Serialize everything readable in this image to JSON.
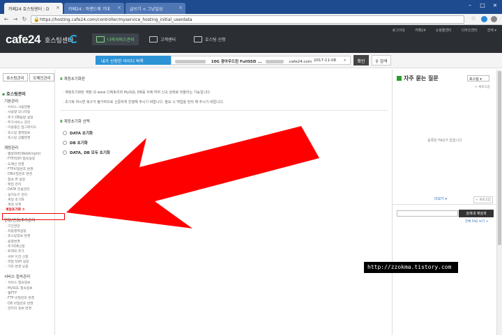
{
  "browser": {
    "tabs": [
      {
        "label": "카페24 호스팅센터 : D",
        "active": true
      },
      {
        "label": "카페24 : 마랜드에 기대",
        "active": false
      },
      {
        "label": "글쓰기 < 그냥일상",
        "active": false
      }
    ],
    "url": "https://hosting.cafe24.com/controller/myservice_hosting_initial_userdata"
  },
  "site": {
    "logo": "cafe24",
    "logo_sub": "호스팅센터",
    "nav": [
      {
        "label": "나의서비스관리",
        "active": true
      },
      {
        "label": "고객센터",
        "active": false
      },
      {
        "label": "호스팅 신청",
        "active": false
      }
    ],
    "utility": [
      "로그아웃",
      "카페24",
      "쇼핑몰센터",
      "디자인센터",
      "전체 ▾"
    ]
  },
  "infobar": {
    "select_label": "내가 신청한 아이디 목록",
    "product": "10G 광아우드린 FullSSD ...",
    "domain": ".cafe24.com",
    "date": "2017-11-08",
    "confirm_label": "확인",
    "search_label": "검색"
  },
  "sidebar": {
    "tabs": [
      "호스팅관리",
      "도메인관리"
    ],
    "section_title": "호스팅관리",
    "groups": [
      {
        "title": "기본관리",
        "items": [
          "서비스 사용현황",
          "사용량 모니터링",
          "추가 DB용량 설정",
          "부가서비스 관리",
          "이용중인 업그레이드",
          "호스팅 결제정보",
          "호스팅 상품변경"
        ]
      },
      {
        "title": "계정관리",
        "items": [
          "웹방화벽(WebKnight)",
          "FTP/SSH 접속설정",
          "도메인 연결",
          "FTP비밀번호 변경",
          "DB비밀번호 변경",
          "접속 IP 설정",
          "백업 관리",
          "DATA 전송관리",
          "설치도구 관리",
          "계정 초기화",
          "계정 삭제",
          "계정초기화 >"
        ]
      },
      {
        "title": "연장/변경/추가관리",
        "items": [
          "기간연장",
          "자동결제설정",
          "호스팅정보 변경",
          "용량변경",
          "추가DB신청",
          "트래픽 추가",
          "서버 이전 신청",
          "파일 SSH 설정",
          "기타 변경 요청"
        ]
      },
      {
        "title": "서비스 접속관리",
        "items": [
          "서비스 접속정보",
          "MySQL 접속정보",
          "웹FTP",
          "FTP 비밀번호 변경",
          "DB 비밀번호 변경",
          "관리자 정보 변경"
        ]
      }
    ],
    "current_item": "계정초기화 >"
  },
  "main": {
    "notice_title": "계정초기화란",
    "notice_lines": [
      "· 계정초기화란 계정 내 www 디렉토리와 MySQL DB를 삭제 하여 신규 상태로 되돌리는 기능입니다.",
      "· 초기화 하시면 복구가 불가하므로 신중하게 진행해 주시기 바랍니다. 필요 시 백업을 먼저 해 주시기 바랍니다."
    ],
    "options_title": "계정초기화 선택",
    "options": [
      "DATA 초기화",
      "DB 초기화",
      "DATA, DB 모두 초기화"
    ]
  },
  "faq": {
    "title": "자주 묻는 질문",
    "select_value": "호스팅 ▾",
    "new_label": "+ 새로고침",
    "empty_text": "등록된 FAQ가 없습니다",
    "more_label": "더보기 ▾",
    "write_label": "+ 새로고침",
    "search_button": "검색내 재검색",
    "link_label": "전체 FAQ 보기 >"
  },
  "watermark": "http://zzokma.tistory.com",
  "colors": {
    "header_bg": "#2b2f34",
    "accent_blue": "#2c93d6",
    "accent_green": "#2a9d2a",
    "arrow_red": "#ff0000"
  }
}
